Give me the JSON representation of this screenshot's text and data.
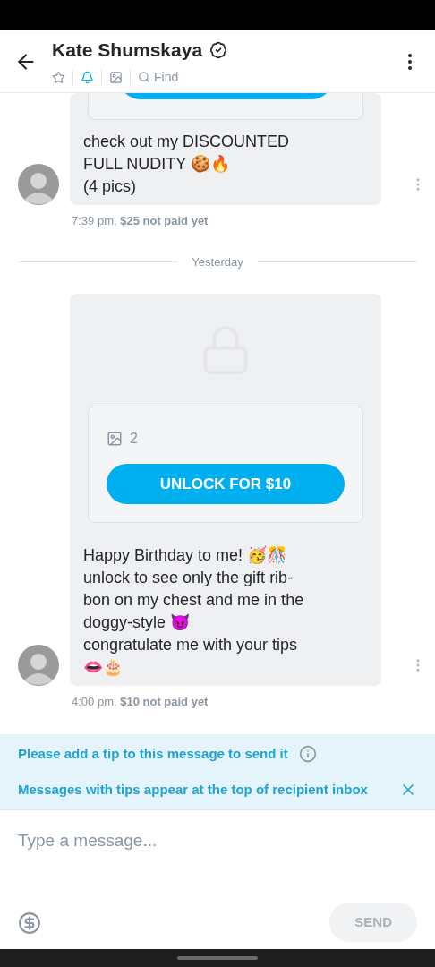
{
  "header": {
    "title": "Kate Shumskaya",
    "verified": true,
    "search_placeholder": "Find",
    "toolbar": [
      {
        "kind": "star",
        "selected": false
      },
      {
        "kind": "bell",
        "selected": true
      },
      {
        "kind": "image",
        "selected": false
      }
    ]
  },
  "items": [
    {
      "kind": "message",
      "partial": true,
      "text": "check out my DISCOUNTED\nFULL NUDITY 🍪🔥\n(4 pics)",
      "meta": "7:39 pm,  **$25 not paid yet**"
    },
    {
      "kind": "divider",
      "label": "Yesterday"
    },
    {
      "kind": "message",
      "partial": false,
      "media_count": "2",
      "unlock_label": "UNLOCK FOR $10",
      "text": "Happy Birthday to me! 🥳🎊\nunlock to see only the gift rib-\nbon on my chest and me in the\ndoggy-style 😈\ncongratulate me with your tips\n👄🎂",
      "meta": "4:00 pm,  **$10 not paid yet**"
    }
  ],
  "notice": {
    "lines": [
      "Please add a tip to this message to send it",
      "Messages with tips appear at the top of recipient inbox"
    ]
  },
  "composer": {
    "placeholder": "Type a message...",
    "send_label": "SEND",
    "send_disabled": true
  }
}
